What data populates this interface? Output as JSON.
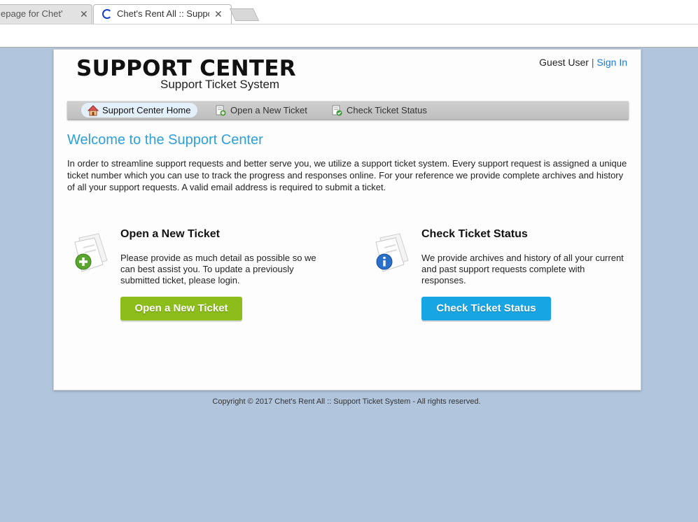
{
  "browser": {
    "tabs": [
      {
        "label": "epage for Chet's we",
        "close": "✕"
      },
      {
        "label": "Chet's Rent All :: Support",
        "close": "✕"
      }
    ]
  },
  "header": {
    "logo_main": "SUPPORT CENTER",
    "logo_sub": "Support Ticket System",
    "user": "Guest User",
    "separator": "|",
    "sign_in": "Sign In"
  },
  "nav": {
    "items": [
      {
        "label": "Support Center Home",
        "icon": "home-icon"
      },
      {
        "label": "Open a New Ticket",
        "icon": "new-ticket-icon"
      },
      {
        "label": "Check Ticket Status",
        "icon": "ticket-status-icon"
      }
    ]
  },
  "main": {
    "title": "Welcome to the Support Center",
    "intro": "In order to streamline support requests and better serve you, we utilize a support ticket system. Every support request is assigned a unique ticket number which you can use to track the progress and responses online. For your reference we provide complete archives and history of all your support requests. A valid email address is required to submit a ticket.",
    "open_ticket": {
      "title": "Open a New Ticket",
      "text": "Please provide as much detail as possible so we can best assist you. To update a previously submitted ticket, please login.",
      "button": "Open a New Ticket"
    },
    "check_status": {
      "title": "Check Ticket Status",
      "text": "We provide archives and history of all your current and past support requests complete with responses.",
      "button": "Check Ticket Status"
    }
  },
  "footer": {
    "copyright": "Copyright © 2017 Chet's Rent All :: Support Ticket System - All rights reserved."
  },
  "colors": {
    "background": "#b1c5dd",
    "accent_blue": "#2e9fd8",
    "button_green": "#8cbd1a",
    "button_blue": "#17a6e3",
    "link": "#1a7ad4"
  }
}
